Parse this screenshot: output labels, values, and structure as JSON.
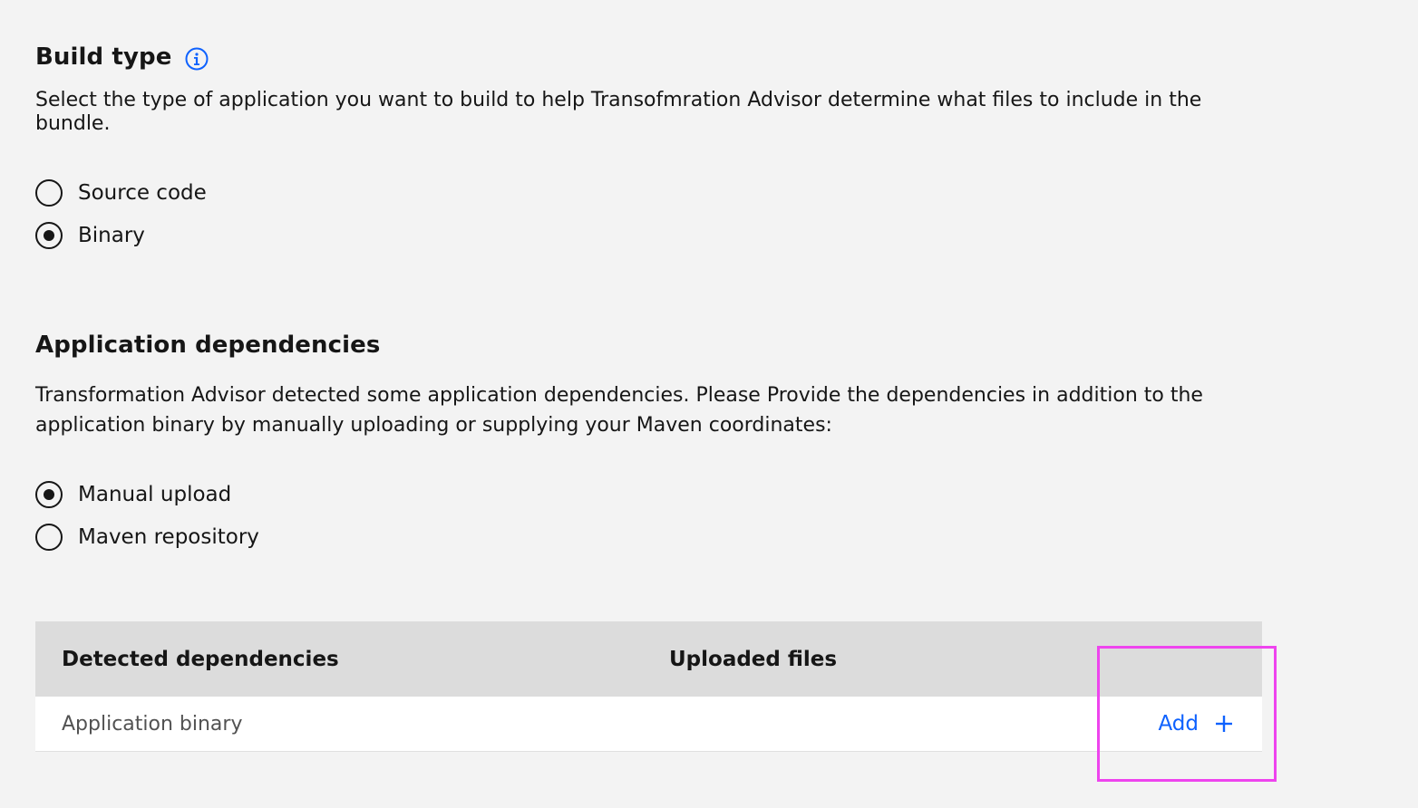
{
  "build_type": {
    "title": "Build type",
    "info_icon": "info-icon",
    "description": "Select the type of application you want to build to help Transofmration Advisor determine what files to include in the bundle.",
    "options": [
      {
        "label": "Source code",
        "selected": false
      },
      {
        "label": "Binary",
        "selected": true
      }
    ]
  },
  "app_dependencies": {
    "title": "Application dependencies",
    "description": "Transformation Advisor detected some application dependencies. Please Provide the dependencies in addition to the application binary by manually uploading or supplying your Maven coordinates:",
    "options": [
      {
        "label": "Manual upload",
        "selected": true
      },
      {
        "label": "Maven repository",
        "selected": false
      }
    ]
  },
  "table": {
    "columns": [
      "Detected dependencies",
      "Uploaded files"
    ],
    "rows": [
      {
        "name": "Application binary",
        "uploaded": "",
        "action_label": "Add",
        "action_icon": "plus-icon"
      }
    ]
  },
  "colors": {
    "background": "#f3f3f3",
    "link": "#0f62fe",
    "header_bg": "#dcdcdc",
    "highlight": "#ee44ee"
  }
}
